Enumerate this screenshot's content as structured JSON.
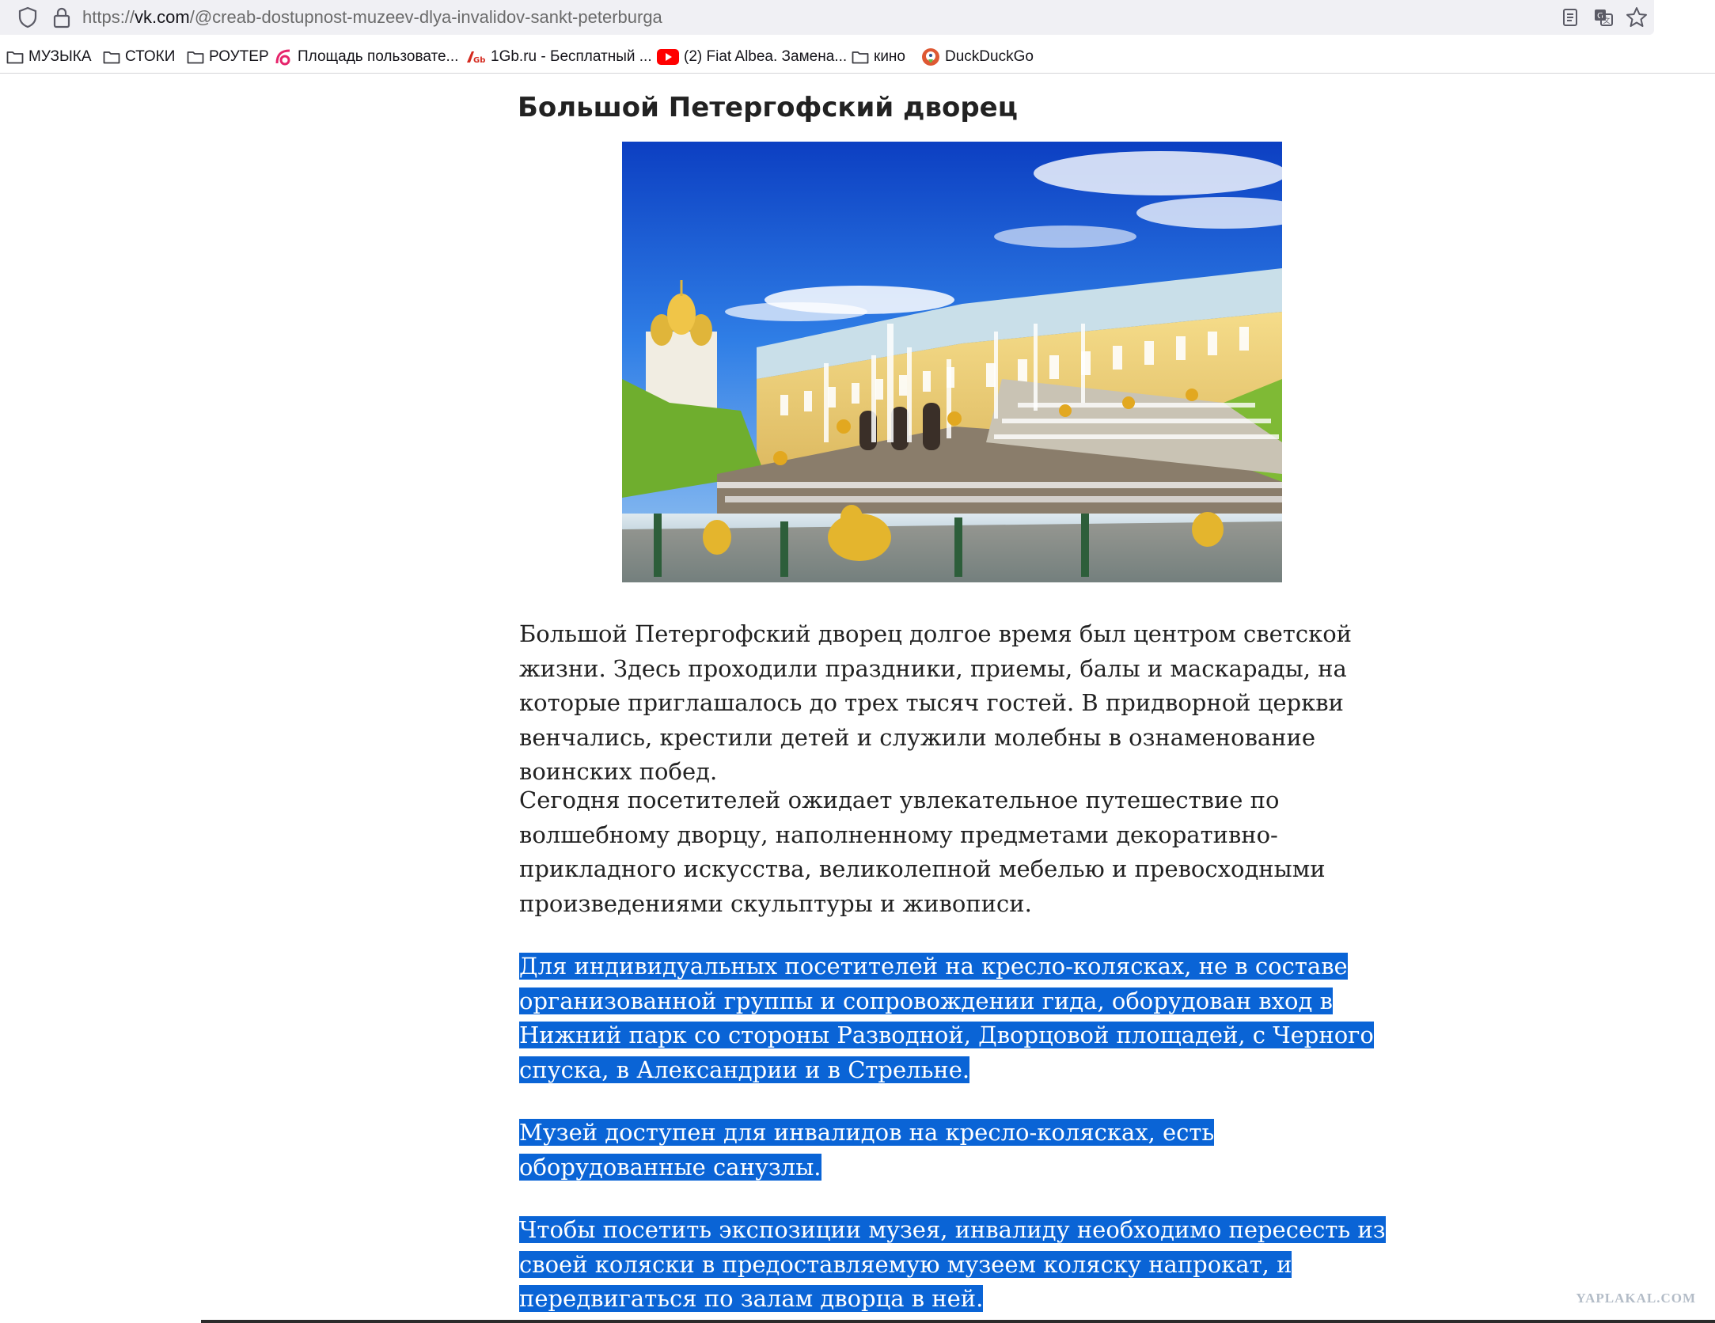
{
  "browser": {
    "url_prefix": "https://",
    "url_host": "vk.com",
    "url_path": "/@creab-dostupnost-muzeev-dlya-invalidov-sankt-peterburga",
    "toolbar_icons": [
      "reader-view-icon",
      "translate-icon",
      "bookmark-star-icon"
    ]
  },
  "bookmarks": [
    {
      "label": "МУЗЫКА",
      "icon": "folder-icon"
    },
    {
      "label": "СТОКИ",
      "icon": "folder-icon"
    },
    {
      "label": "РОУТЕР",
      "icon": "folder-icon"
    },
    {
      "label": "Площадь пользовате...",
      "icon": "pink-swirl-icon"
    },
    {
      "label": "1Gb.ru - Бесплатный ...",
      "icon": "1gb-icon"
    },
    {
      "label": "(2) Fiat Albea. Замена...",
      "icon": "youtube-icon"
    },
    {
      "label": "кино",
      "icon": "folder-icon"
    },
    {
      "label": "DuckDuckGo",
      "icon": "duckduckgo-icon"
    }
  ],
  "article": {
    "title": "Большой Петергофский дворец",
    "photo_description_icon": "palace-photo",
    "paragraphs": [
      {
        "text": "Большой Петергофский дворец долгое время был центром светской жизни. Здесь проходили праздники, приемы, балы и маскарады, на которые приглашалось до трех тысяч гостей. В придворной церкви венчались, крестили детей и служили молебны в ознаменование воинских побед.",
        "selected": false
      },
      {
        "text": "Сегодня посетителей ожидает увлекательное путешествие по волшебному дворцу, наполненному предметами декоративно-прикладного искусства, великолепной мебелью и превосходными произведениями скульптуры и живописи.",
        "selected": false
      },
      {
        "text": "Для индивидуальных посетителей на кресло-колясках, не в составе организованной группы и сопровождении гида, оборудован вход в Нижний парк со стороны Разводной, Дворцовой площадей, с Черного спуска, в Александрии и в Стрельне.",
        "selected": true
      },
      {
        "text": "Музей доступен для инвалидов на кресло-колясках, есть оборудованные санузлы.",
        "selected": true
      },
      {
        "text": "Чтобы посетить экспозиции музея, инвалиду необходимо пересесть из своей коляски в предоставляемую музеем коляску напрокат, и передвигаться по залам дворца в ней.",
        "selected": true
      }
    ]
  },
  "watermark": "YAPLAKAL.COM",
  "colors": {
    "selection": "#0a64d6",
    "text": "#222222",
    "chrome": "#f0f0f4"
  }
}
